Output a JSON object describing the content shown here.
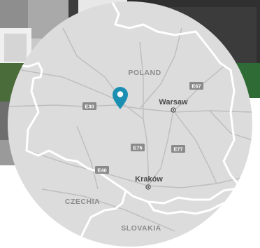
{
  "map": {
    "countries": {
      "poland": "POLAND",
      "czechia": "CZECHIA",
      "slovakia": "SLOVAKIA"
    },
    "cities": {
      "warsaw": "Warsaw",
      "krakow": "Kraków"
    },
    "roads": {
      "e30": "E30",
      "e67": "E67",
      "e75": "E75",
      "e77": "E77",
      "e40": "E40"
    },
    "colors": {
      "land": "#dcdcdc",
      "road": "#bdbdbd",
      "border": "#ffffff",
      "shield": "#8a8a8a",
      "pin": "#1b8fb2",
      "country_label": "#8c8c8c",
      "city_label": "#4a4a4a"
    },
    "marker": {
      "icon": "location-pin-icon"
    }
  }
}
